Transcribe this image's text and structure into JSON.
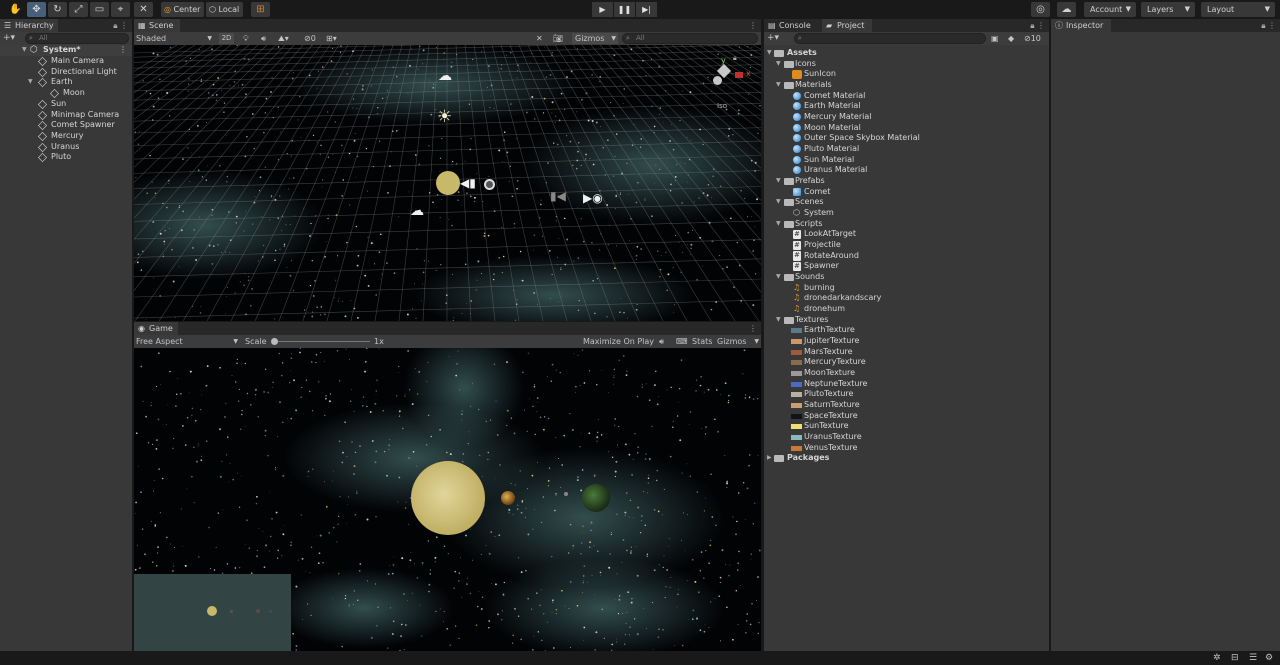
{
  "toolbar": {
    "pivot": "Center",
    "space": "Local",
    "account": "Account",
    "layers": "Layers",
    "layout": "Layout"
  },
  "hierarchy": {
    "tab": "Hierarchy",
    "search_placeholder": "All",
    "root": "System*",
    "items": [
      {
        "label": "Main Camera",
        "depth": 1
      },
      {
        "label": "Directional Light",
        "depth": 1
      },
      {
        "label": "Earth",
        "depth": 1,
        "expanded": true
      },
      {
        "label": "Moon",
        "depth": 2
      },
      {
        "label": "Sun",
        "depth": 1
      },
      {
        "label": "Minimap Camera",
        "depth": 1
      },
      {
        "label": "Comet Spawner",
        "depth": 1
      },
      {
        "label": "Mercury",
        "depth": 1
      },
      {
        "label": "Uranus",
        "depth": 1
      },
      {
        "label": "Pluto",
        "depth": 1
      }
    ]
  },
  "scene": {
    "tab": "Scene",
    "shading": "Shaded",
    "mode_2d": "2D",
    "hidden_count": "0",
    "gizmos": "Gizmos",
    "search_placeholder": "All",
    "projection": "Iso",
    "axis_x": "x",
    "axis_y": "y"
  },
  "game": {
    "tab": "Game",
    "aspect": "Free Aspect",
    "scale_label": "Scale",
    "scale_value": "1x",
    "maximize": "Maximize On Play",
    "stats": "Stats",
    "gizmos": "Gizmos"
  },
  "project": {
    "tab_console": "Console",
    "tab_project": "Project",
    "hidden_count": "10",
    "root": "Assets",
    "folders": [
      {
        "name": "Icons",
        "items": [
          {
            "label": "SunIcon",
            "kind": "icon"
          }
        ]
      },
      {
        "name": "Materials",
        "items": [
          {
            "label": "Comet Material",
            "kind": "material"
          },
          {
            "label": "Earth Material",
            "kind": "material"
          },
          {
            "label": "Mercury Material",
            "kind": "material"
          },
          {
            "label": "Moon Material",
            "kind": "material"
          },
          {
            "label": "Outer Space Skybox Material",
            "kind": "material"
          },
          {
            "label": "Pluto Material",
            "kind": "material"
          },
          {
            "label": "Sun Material",
            "kind": "material"
          },
          {
            "label": "Uranus Material",
            "kind": "material"
          }
        ]
      },
      {
        "name": "Prefabs",
        "items": [
          {
            "label": "Comet",
            "kind": "prefab"
          }
        ]
      },
      {
        "name": "Scenes",
        "items": [
          {
            "label": "System",
            "kind": "scene"
          }
        ]
      },
      {
        "name": "Scripts",
        "items": [
          {
            "label": "LookAtTarget",
            "kind": "script"
          },
          {
            "label": "Projectile",
            "kind": "script"
          },
          {
            "label": "RotateAround",
            "kind": "script"
          },
          {
            "label": "Spawner",
            "kind": "script"
          }
        ]
      },
      {
        "name": "Sounds",
        "items": [
          {
            "label": "burning",
            "kind": "audio"
          },
          {
            "label": "dronedarkandscary",
            "kind": "audio"
          },
          {
            "label": "dronehum",
            "kind": "audio"
          }
        ]
      },
      {
        "name": "Textures",
        "items": [
          {
            "label": "EarthTexture",
            "kind": "texture",
            "color": "#5a7a8a"
          },
          {
            "label": "JupiterTexture",
            "kind": "texture",
            "color": "#c89a6a"
          },
          {
            "label": "MarsTexture",
            "kind": "texture",
            "color": "#a05a3a"
          },
          {
            "label": "MercuryTexture",
            "kind": "texture",
            "color": "#8a6a4a"
          },
          {
            "label": "MoonTexture",
            "kind": "texture",
            "color": "#9a9a9a"
          },
          {
            "label": "NeptuneTexture",
            "kind": "texture",
            "color": "#4a6ac8"
          },
          {
            "label": "PlutoTexture",
            "kind": "texture",
            "color": "#b8b0a0"
          },
          {
            "label": "SaturnTexture",
            "kind": "texture",
            "color": "#c8a070"
          },
          {
            "label": "SpaceTexture",
            "kind": "texture",
            "color": "#101418"
          },
          {
            "label": "SunTexture",
            "kind": "texture",
            "color": "#f0e070"
          },
          {
            "label": "UranusTexture",
            "kind": "texture",
            "color": "#8ab8c0"
          },
          {
            "label": "VenusTexture",
            "kind": "texture",
            "color": "#c87a30"
          }
        ]
      }
    ],
    "packages": "Packages"
  },
  "inspector": {
    "tab": "Inspector"
  },
  "colors": {
    "panel": "#383838",
    "tabbar": "#282828",
    "selection": "#46607c",
    "sun": "#c8b86a",
    "nebula": "#5a8a8a"
  }
}
